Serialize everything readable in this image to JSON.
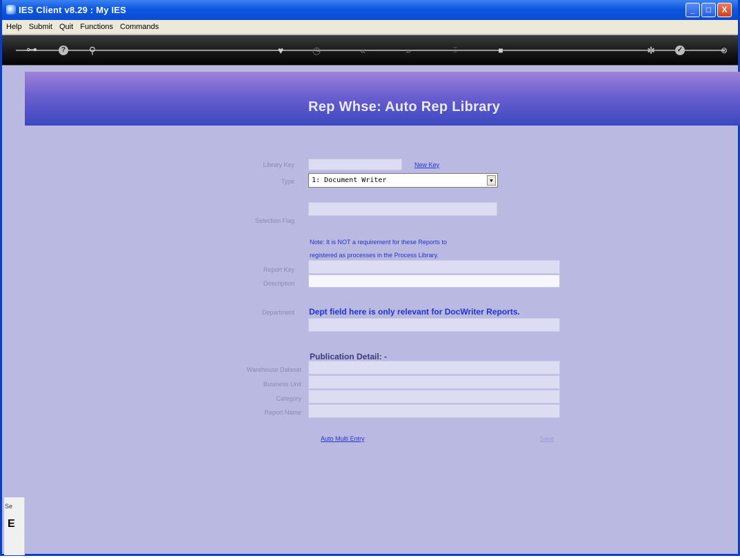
{
  "window": {
    "title": "IES Client v8.29 : My IES",
    "buttons": {
      "minimize": "_",
      "maximize": "□",
      "close": "X"
    }
  },
  "menu": [
    "Help",
    "Submit",
    "Quit",
    "Functions",
    "Commands"
  ],
  "toolbar": {
    "icons": [
      "key-icon",
      "help-icon",
      "search-icon",
      "heart-icon",
      "clock-icon",
      "back-icon",
      "forward-icon",
      "insert-icon",
      "stop-icon",
      "settings-icon",
      "check-icon",
      "close-icon"
    ]
  },
  "page": {
    "title": "Rep Whse: Auto Rep Library"
  },
  "form": {
    "library_key_label": "Library Key",
    "new_key_link": "New Key",
    "type_label": "Type",
    "type_value": "1: Document Writer",
    "selection_flag_label": "Selection Flag",
    "note_line1": "Note: It is NOT a requirement for these Reports to",
    "note_line2": "registered as processes in the Process Library.",
    "report_key_label": "Report Key",
    "description_label": "Description",
    "department_label": "Department",
    "department_note": "Dept field here is only relevant for  DocWriter Reports.",
    "publication_heading": "Publication Detail: -",
    "warehouse_label": "Warehouse Dataset",
    "business_unit_label": "Business Unit",
    "category_label": "Category",
    "report_name_label": "Report Name",
    "auto_multi_entry": "Auto Multi Entry",
    "save": "Save"
  },
  "side": {
    "top": "Se",
    "bottom": "E"
  }
}
